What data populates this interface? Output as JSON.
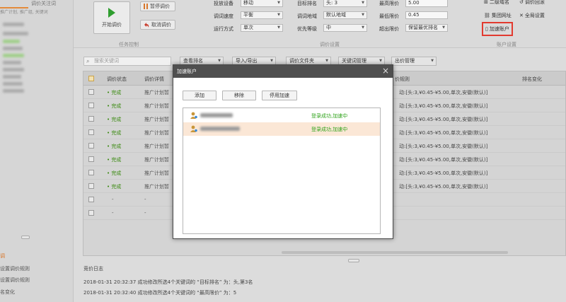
{
  "left": {
    "tabs": [
      "",
      "调价关注词"
    ],
    "tree_hint": "推广计划, 推广组, 关键词",
    "bottom_items": [
      "调",
      "设置调价规则",
      "设置调价规则",
      "名变化"
    ]
  },
  "toolbar": {
    "start_label": "开始调价",
    "pause_label": "暂停调价",
    "cancel_label": "取消调价",
    "group_task": "任务控制",
    "group_settings": "调价设置",
    "group_account": "账户设置",
    "fields": {
      "device_label": "投放设备",
      "device_value": "移动",
      "speed_label": "调词速度",
      "speed_value": "平衡",
      "mode_label": "运行方式",
      "mode_value": "单次",
      "target_label": "目标排名",
      "target_value": "头: 3",
      "region_label": "调词地域",
      "region_value": "默认地域",
      "priority_label": "优先等级",
      "priority_value": "中",
      "maxbid_label": "最高限价",
      "maxbid_value": "5.00",
      "minbid_label": "最低限价",
      "minbid_value": "0.45",
      "over_label": "超出限价",
      "over_value": "保留最优排名"
    },
    "right_links": [
      "二级域名",
      "调价回滚",
      "集团网址",
      "全局设置",
      "加速账户"
    ]
  },
  "search": {
    "placeholder": "搜索关键词"
  },
  "filters": [
    "查看排名",
    "导入/导出",
    "调价文件夹",
    "关键词管理",
    "出价管理"
  ],
  "table": {
    "headers": [
      "调价状态",
      "调价详情",
      "价规则",
      "排名变化"
    ],
    "rows": [
      {
        "status": "• 完成",
        "detail": "推广计划暂",
        "rule": "动:[头:3,¥0.45-¥5.00,单次,安徽(默认)]"
      },
      {
        "status": "• 完成",
        "detail": "推广计划暂",
        "rule": "动:[头:3,¥0.45-¥5.00,单次,安徽(默认)]"
      },
      {
        "status": "• 完成",
        "detail": "推广计划暂",
        "rule": "动:[头:3,¥0.45-¥5.00,单次,安徽(默认)]"
      },
      {
        "status": "• 完成",
        "detail": "推广计划暂",
        "rule": "动:[头:3,¥0.45-¥5.00,单次,安徽(默认)]"
      },
      {
        "status": "• 完成",
        "detail": "推广计划暂",
        "rule": "动:[头:3,¥0.45-¥5.00,单次,安徽(默认)]"
      },
      {
        "status": "• 完成",
        "detail": "推广计划暂",
        "rule": "动:[头:3,¥0.45-¥5.00,单次,安徽(默认)]"
      },
      {
        "status": "• 完成",
        "detail": "推广计划暂",
        "rule": "动:[头:3,¥0.45-¥5.00,单次,安徽(默认)]"
      },
      {
        "status": "• 完成",
        "detail": "推广计划暂",
        "rule": "动:[头:3,¥0.45-¥5.00,单次,安徽(默认)]"
      },
      {
        "status": "-",
        "detail": "-",
        "rule": ""
      },
      {
        "status": "-",
        "detail": "-",
        "rule": ""
      }
    ]
  },
  "log": {
    "title": "竞价日志",
    "lines": [
      "2018-01-31 20:32:37  成功修改所选4个关键词的 “目标排名” 为：头,第3名",
      "2018-01-31 20:32:40  成功修改所选4个关键词的 “最高限价” 为：5"
    ]
  },
  "dialog": {
    "title": "加速账户",
    "close_glyph": "×",
    "add_label": "添加",
    "remove_label": "移除",
    "disable_label": "停用加速",
    "accounts": [
      {
        "status": "登录成功,加速中"
      },
      {
        "status": "登录成功,加速中"
      }
    ]
  },
  "colors": {
    "highlight_box": "#e23a2f",
    "selected_row": "#fbe7d6",
    "success_green": "#2fa31a",
    "titlebar": "#4f4f4f",
    "play_green": "#2f9e2f"
  },
  "icons": [
    "play-icon",
    "pause-icon",
    "undo-icon",
    "search-icon",
    "user-icon",
    "link-icon",
    "gear-icon",
    "close-icon"
  ]
}
